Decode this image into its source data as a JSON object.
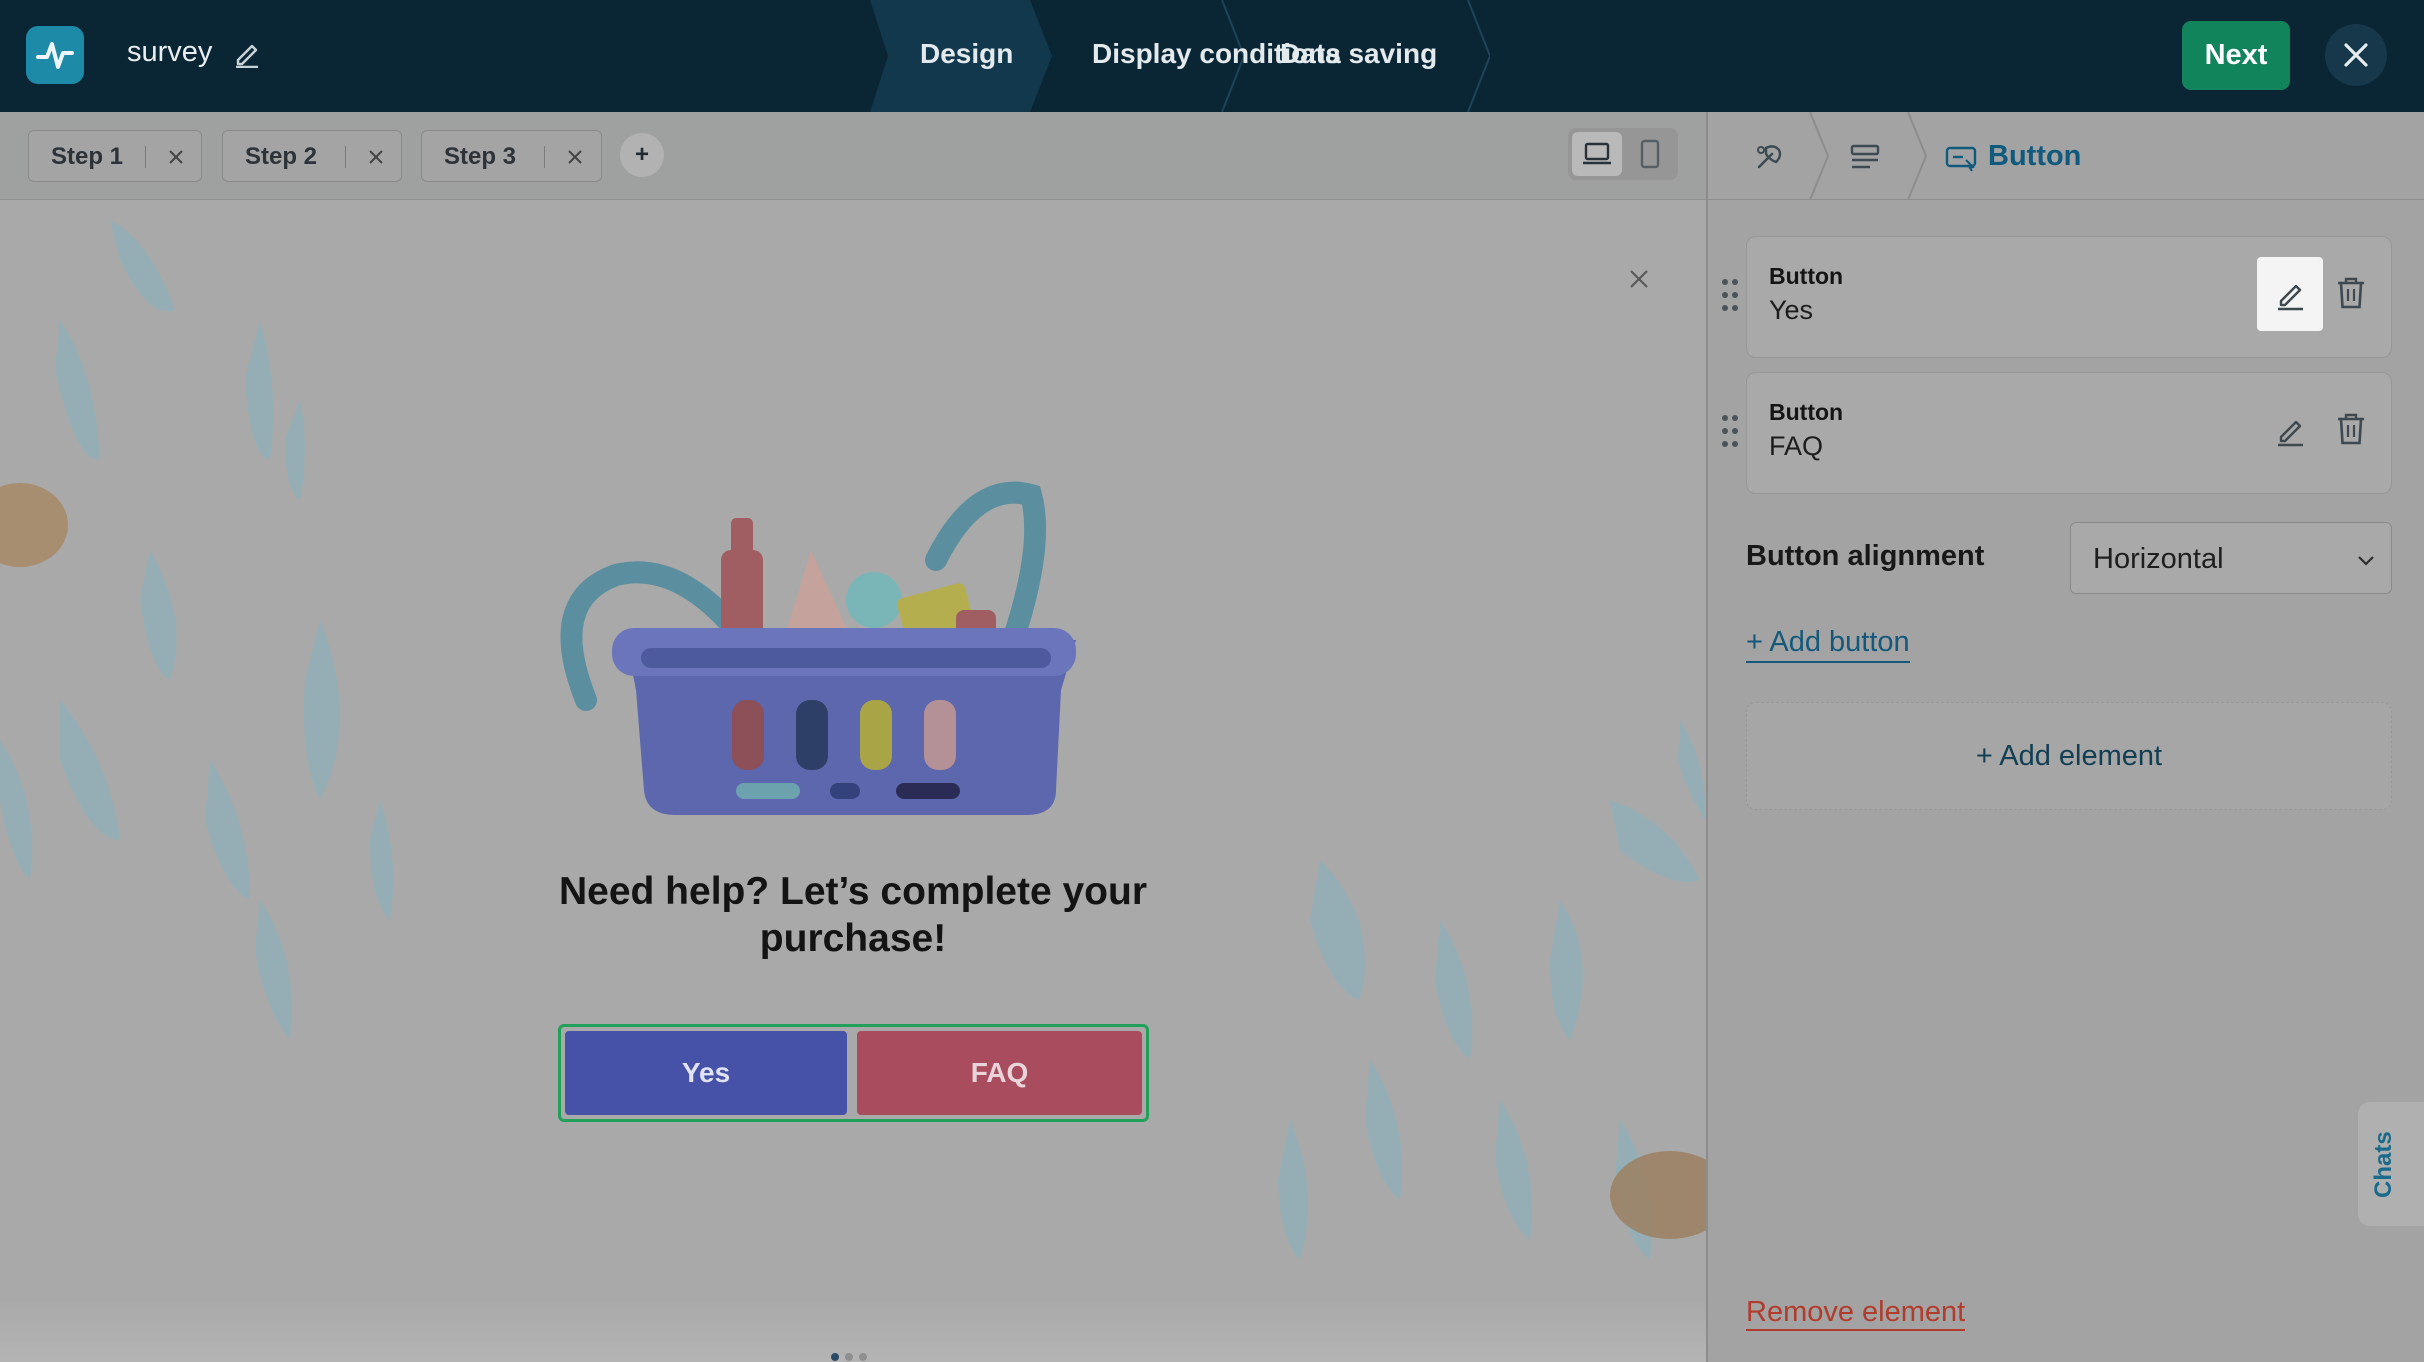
{
  "topbar": {
    "survey_name": "survey",
    "wizard_steps": [
      {
        "label": "Design",
        "active": true
      },
      {
        "label": "Display conditions",
        "active": false
      },
      {
        "label": "Data saving",
        "active": false
      }
    ],
    "next_label": "Next"
  },
  "steps": {
    "tabs": [
      {
        "label": "Step 1",
        "active": true
      },
      {
        "label": "Step 2",
        "active": false
      },
      {
        "label": "Step 3",
        "active": false
      }
    ],
    "add_label": "+",
    "view_mode": "desktop"
  },
  "popup": {
    "headline": "Need help? Let’s complete your purchase!",
    "buttons": [
      {
        "label": "Yes",
        "color": "#4652a8"
      },
      {
        "label": "FAQ",
        "color": "#a94c5e"
      }
    ]
  },
  "panel": {
    "breadcrumb": {
      "items": [
        "design-icon",
        "form-icon"
      ],
      "current": "Button"
    },
    "items": [
      {
        "title": "Button",
        "value": "Yes",
        "edit_highlighted": true
      },
      {
        "title": "Button",
        "value": "FAQ",
        "edit_highlighted": false
      }
    ],
    "alignment": {
      "label": "Button alignment",
      "value": "Horizontal"
    },
    "add_button_label": "+ Add button",
    "add_element_label": "+ Add element",
    "remove_element_label": "Remove element",
    "chats_label": "Chats"
  },
  "colors": {
    "accent": "#14597c",
    "next": "#12845b",
    "danger": "#b23c2c",
    "selection": "#21a05a"
  }
}
